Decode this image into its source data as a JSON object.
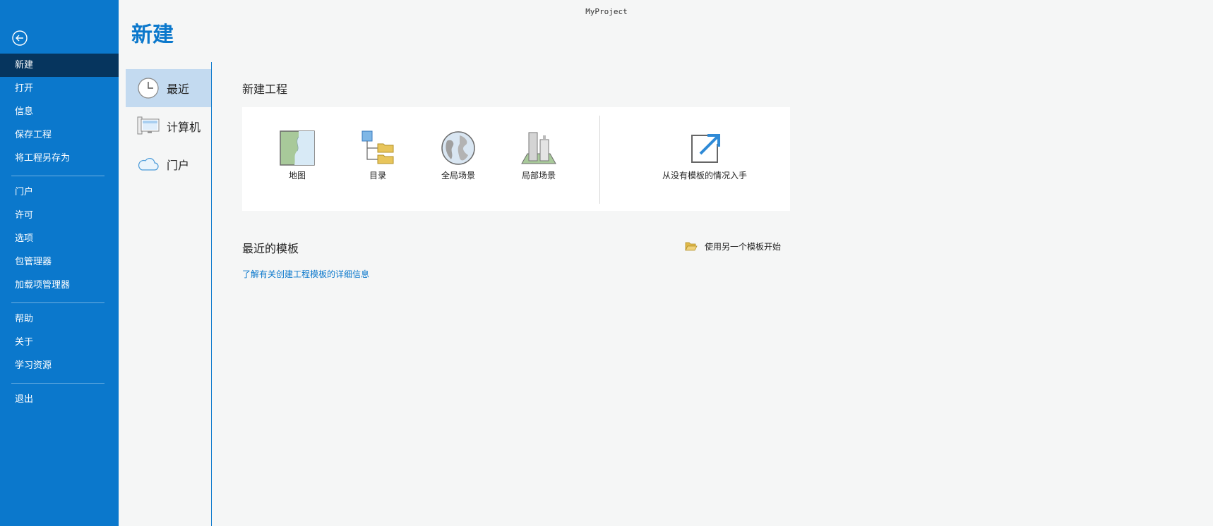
{
  "window": {
    "title": "MyProject"
  },
  "page": {
    "title": "新建"
  },
  "sidebar": {
    "back_icon": "back-arrow-icon",
    "groups": [
      [
        "新建",
        "打开",
        "信息",
        "保存工程",
        "将工程另存为"
      ],
      [
        "门户",
        "许可",
        "选项",
        "包管理器",
        "加载项管理器"
      ],
      [
        "帮助",
        "关于",
        "学习资源"
      ],
      [
        "退出"
      ]
    ]
  },
  "subnav": {
    "items": [
      {
        "label": "最近",
        "icon": "clock-icon"
      },
      {
        "label": "计算机",
        "icon": "computer-icon"
      },
      {
        "label": "门户",
        "icon": "cloud-icon"
      }
    ]
  },
  "new_project": {
    "title": "新建工程",
    "tiles": [
      {
        "label": "地图",
        "icon": "map-icon"
      },
      {
        "label": "目录",
        "icon": "catalog-icon"
      },
      {
        "label": "全局场景",
        "icon": "globe-icon"
      },
      {
        "label": "局部场景",
        "icon": "local-scene-icon"
      }
    ],
    "blank_label": "从没有模板的情况入手"
  },
  "recent_templates": {
    "title": "最近的模板",
    "alt_button": "使用另一个模板开始",
    "learn_link": "了解有关创建工程模板的详细信息"
  },
  "colors": {
    "accent": "#0b78cc",
    "active_nav": "#06355e",
    "subnav_active": "#c3daf0"
  }
}
